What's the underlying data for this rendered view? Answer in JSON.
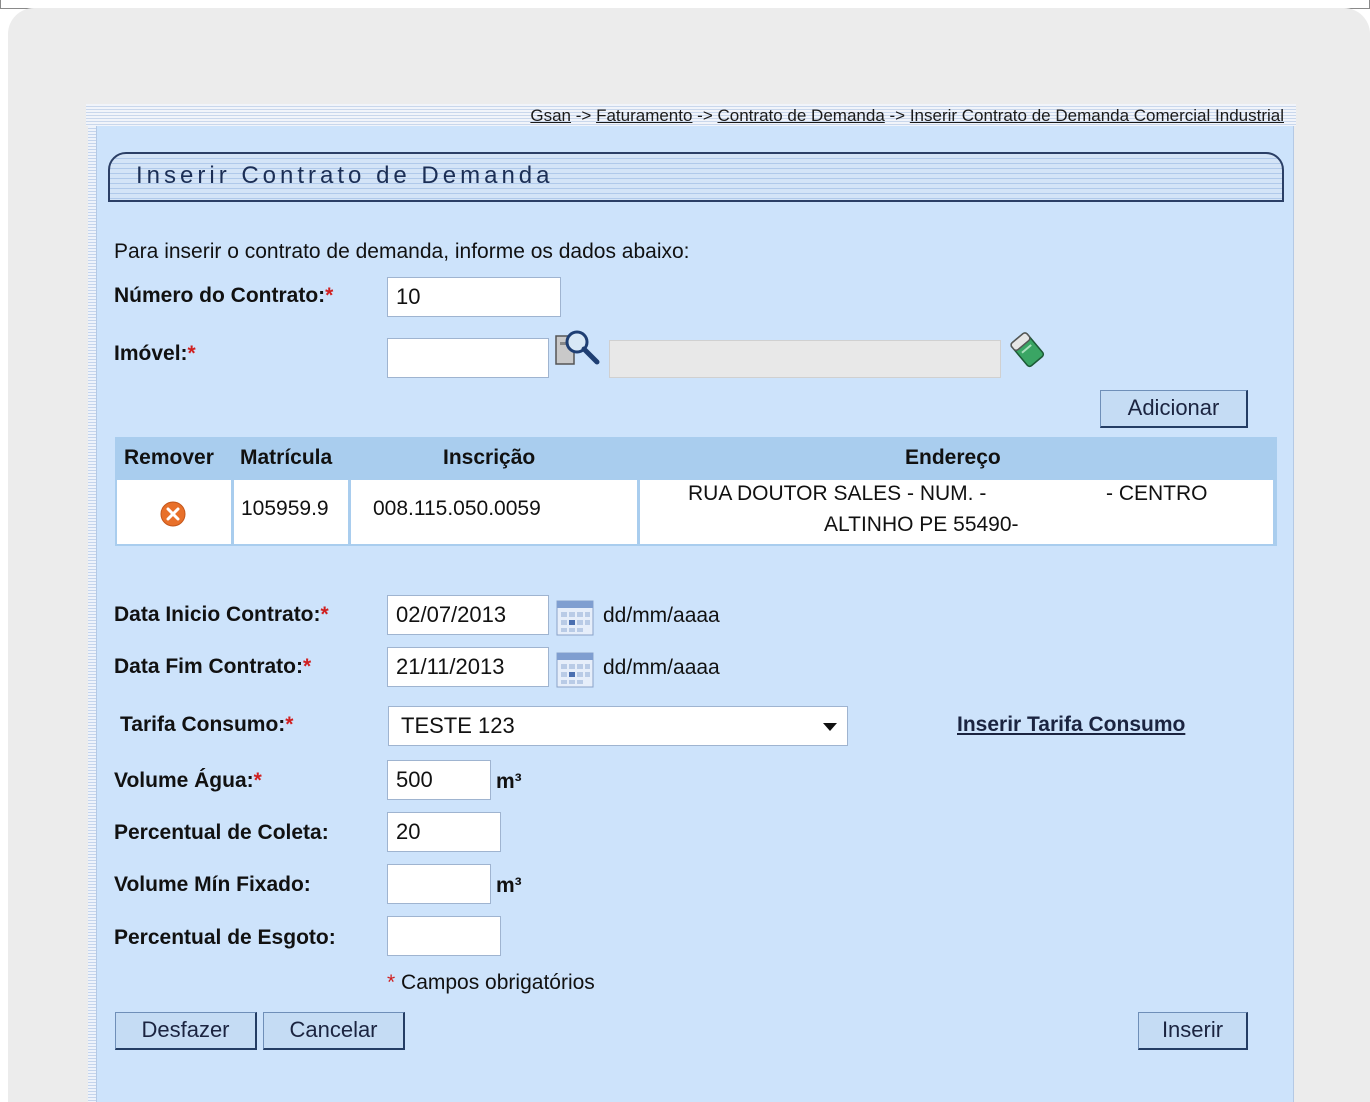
{
  "breadcrumb": {
    "items": [
      "Gsan",
      "Faturamento",
      "Contrato de Demanda",
      "Inserir Contrato de Demanda Comercial Industrial"
    ],
    "separator": " -> "
  },
  "page_title": "Inserir Contrato de Demanda",
  "intro": "Para inserir o contrato de demanda, informe os dados abaixo:",
  "form": {
    "numero_label": "Número do Contrato:",
    "numero_value": "10",
    "imovel_label": "Imóvel:",
    "imovel_value": "",
    "imovel_desc": "",
    "adicionar_label": "Adicionar",
    "data_inicio_label": "Data Inicio Contrato:",
    "data_inicio_value": "02/07/2013",
    "data_fim_label": "Data Fim Contrato:",
    "data_fim_value": "21/11/2013",
    "date_hint": "dd/mm/aaaa",
    "tarifa_label": "Tarifa Consumo:",
    "tarifa_value": "TESTE 123",
    "inserir_tarifa_link": "Inserir Tarifa Consumo",
    "volume_agua_label": "Volume Água:",
    "volume_agua_value": "500",
    "unit_m3": "m³",
    "perc_coleta_label": "Percentual de Coleta:",
    "perc_coleta_value": "20",
    "volume_min_label": "Volume Mín Fixado:",
    "volume_min_value": "",
    "perc_esgoto_label": "Percentual de Esgoto:",
    "perc_esgoto_value": "",
    "required_mark": "*",
    "required_note": "Campos obrigatórios"
  },
  "table": {
    "headers": [
      "Remover",
      "Matrícula",
      "Inscrição",
      "Endereço"
    ],
    "rows": [
      {
        "matricula": "105959.9",
        "inscricao": "008.115.050.0059",
        "endereco_line1": "RUA DOUTOR SALES - NUM. -",
        "endereco_centro": "- CENTRO",
        "endereco_line2": "ALTINHO PE 55490-"
      }
    ]
  },
  "buttons": {
    "desfazer": "Desfazer",
    "cancelar": "Cancelar",
    "inserir": "Inserir"
  },
  "colors": {
    "panel_bg": "#cde3fb",
    "table_header_bg": "#a9cdee",
    "remove_icon": "#e8702a",
    "required": "#d02020"
  }
}
